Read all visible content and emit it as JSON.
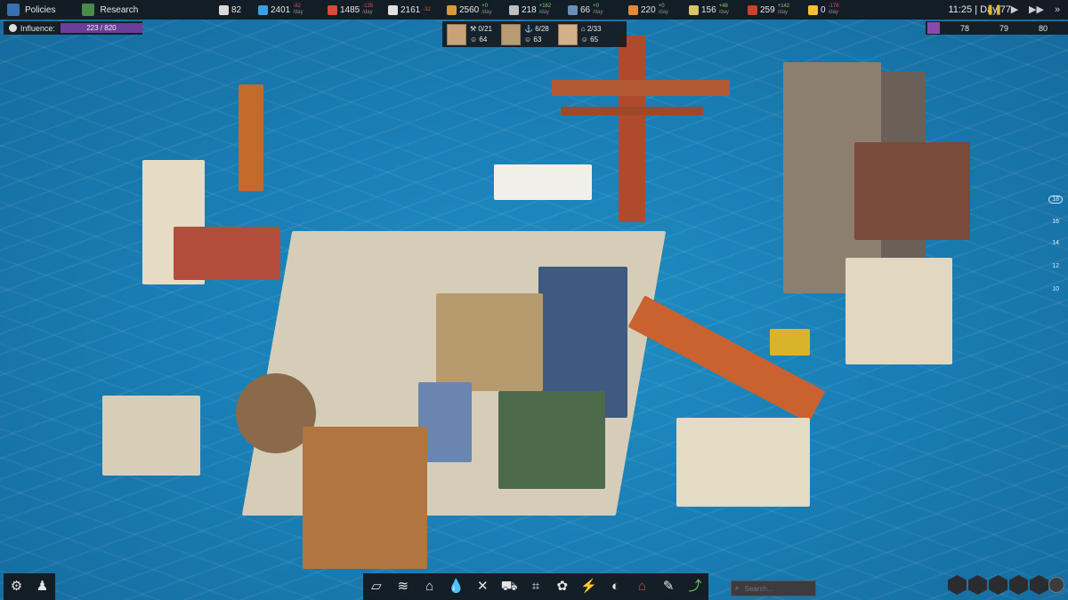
{
  "topbar": {
    "policies": "Policies",
    "research": "Research",
    "resources": [
      {
        "value": "82",
        "delta_top": "",
        "delta_bottom": "",
        "color": "#d9d9d9"
      },
      {
        "value": "2401",
        "delta_top": "-82",
        "delta_bottom": "/day",
        "color": "#3aa0e6"
      },
      {
        "value": "1485",
        "delta_top": "-135",
        "delta_bottom": "/day",
        "color": "#d9483a"
      },
      {
        "value": "2161",
        "delta_top": "-32",
        "delta_bottom": "",
        "color": "#e0e0e0"
      },
      {
        "value": "2560",
        "delta_top": "+0",
        "delta_bottom": "/day",
        "color": "#d99a3a"
      },
      {
        "value": "218",
        "delta_top": "+162",
        "delta_bottom": "/day",
        "color": "#bfbfbf"
      },
      {
        "value": "66",
        "delta_top": "+0",
        "delta_bottom": "/day",
        "color": "#6a8fb8"
      },
      {
        "value": "220",
        "delta_top": "+0",
        "delta_bottom": "/day",
        "color": "#e08a3a"
      },
      {
        "value": "156",
        "delta_top": "+48",
        "delta_bottom": "/day",
        "color": "#d9c46a"
      },
      {
        "value": "259",
        "delta_top": "+142",
        "delta_bottom": "/day",
        "color": "#c9432a"
      },
      {
        "value": "0",
        "delta_top": "-178",
        "delta_bottom": "/day",
        "color": "#f2c12e"
      }
    ],
    "time": "11:25 | Day 77"
  },
  "influence": {
    "label": "Influence:",
    "value": "223 / 820",
    "fraction": 0.272
  },
  "population": [
    {
      "work": "0/21",
      "happiness": "64"
    },
    {
      "work": "6/28",
      "happiness": "63"
    },
    {
      "work": "2/33",
      "happiness": "65"
    }
  ],
  "temperature": {
    "values": [
      "78",
      "79",
      "80"
    ]
  },
  "scale_marks": [
    "18",
    "16",
    "14",
    "12",
    "10"
  ],
  "search": {
    "placeholder": "Search..."
  }
}
